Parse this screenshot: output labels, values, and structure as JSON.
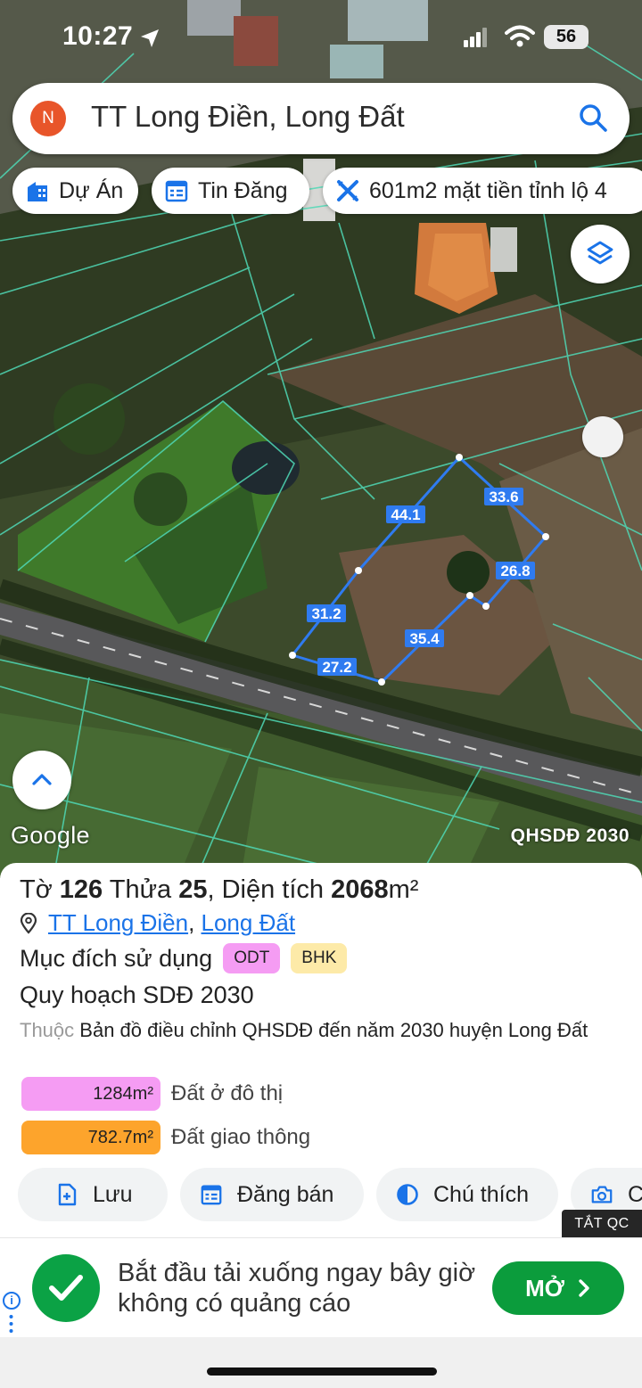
{
  "status": {
    "time": "10:27",
    "battery": "56"
  },
  "search": {
    "avatar_letter": "N",
    "query": "TT Long Điền, Long Đất"
  },
  "chips": [
    {
      "label": "Dự Án",
      "icon": "building-icon"
    },
    {
      "label": "Tin Đăng",
      "icon": "calendar-list-icon"
    },
    {
      "label": "601m2 mặt tiền tỉnh lộ 4",
      "icon": "ruler-cross-icon"
    }
  ],
  "map": {
    "google_logo": "Google",
    "plan_label": "QHSDĐ 2030",
    "edge_lengths": [
      "44.1",
      "33.6",
      "26.8",
      "35.4",
      "27.2",
      "31.2"
    ]
  },
  "parcel": {
    "sheet_label": "Tờ",
    "sheet": "126",
    "plot_label": "Thửa",
    "plot": "25",
    "area_label": "Diện tích",
    "area": "2068",
    "area_unit": "m²",
    "ward": "TT Long Điền",
    "district": "Long Đất",
    "purpose_label": "Mục đích sử dụng",
    "purposes": [
      "ODT",
      "BHK"
    ],
    "plan_heading": "Quy hoạch SDĐ 2030",
    "belongs_label": "Thuộc",
    "belongs_text": "Bản đồ điều chỉnh QHSDĐ đến năm 2030 huyện Long Đất",
    "zones": [
      {
        "area": "1284m²",
        "label": "Đất ở đô thị",
        "color": "#f59cf3"
      },
      {
        "area": "782.7m²",
        "label": "Đất giao thông",
        "color": "#fda42c"
      }
    ]
  },
  "actions": [
    {
      "label": "Lưu",
      "icon": "save-plus-icon"
    },
    {
      "label": "Đăng bán",
      "icon": "calendar-list-icon"
    },
    {
      "label": "Chú thích",
      "icon": "half-circle-icon"
    },
    {
      "label": "C",
      "icon": "camera-icon"
    }
  ],
  "ad": {
    "close_label": "TẮT QC",
    "text": "Bắt đầu tải xuống ngay bây giờ không có quảng cáo",
    "open_label": "MỞ"
  },
  "colors": {
    "accent": "#1a73e8",
    "parcel_line": "#2f7bf0",
    "ad_green": "#0b9c3c"
  }
}
